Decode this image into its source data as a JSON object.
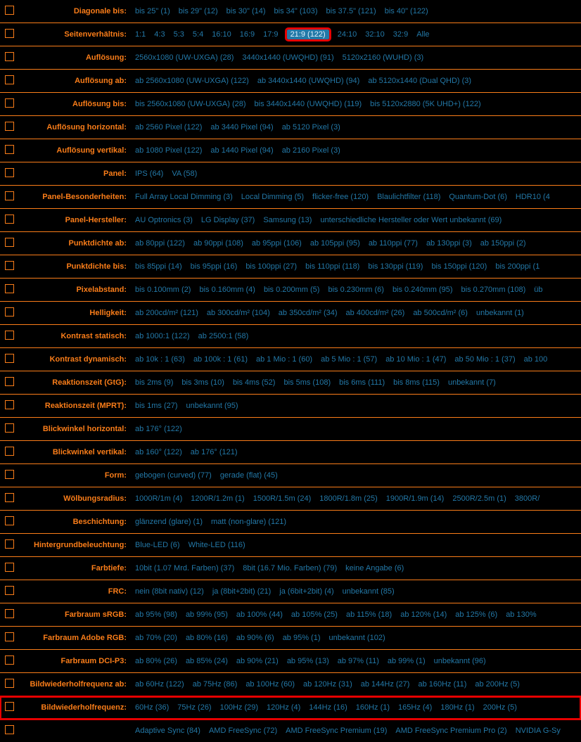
{
  "rows": [
    {
      "label": "Diagonale bis:",
      "opts": [
        [
          "bis 25\" (1)",
          0
        ],
        [
          "bis 29\" (12)",
          0
        ],
        [
          "bis 30\" (14)",
          0
        ],
        [
          "bis 34\" (103)",
          0
        ],
        [
          "bis 37.5\" (121)",
          0
        ],
        [
          "bis 40\" (122)",
          0
        ]
      ]
    },
    {
      "label": "Seitenverhältnis:",
      "hl": 1,
      "opts": [
        [
          "1:1",
          0
        ],
        [
          "4:3",
          0
        ],
        [
          "5:3",
          0
        ],
        [
          "5:4",
          0
        ],
        [
          "16:10",
          0
        ],
        [
          "16:9",
          0
        ],
        [
          "17:9",
          0
        ],
        [
          "21:9 (122)",
          1
        ],
        [
          "24:10",
          0
        ],
        [
          "32:10",
          0
        ],
        [
          "32:9",
          0
        ],
        [
          "Alle",
          0
        ]
      ]
    },
    {
      "label": "Auflösung:",
      "opts": [
        [
          "2560x1080 (UW-UXGA) (28)",
          0
        ],
        [
          "3440x1440 (UWQHD) (91)",
          0
        ],
        [
          "5120x2160 (WUHD) (3)",
          0
        ]
      ]
    },
    {
      "label": "Auflösung ab:",
      "opts": [
        [
          "ab 2560x1080 (UW-UXGA) (122)",
          0
        ],
        [
          "ab 3440x1440 (UWQHD) (94)",
          0
        ],
        [
          "ab 5120x1440 (Dual QHD) (3)",
          0
        ]
      ]
    },
    {
      "label": "Auflösung bis:",
      "opts": [
        [
          "bis 2560x1080 (UW-UXGA) (28)",
          0
        ],
        [
          "bis 3440x1440 (UWQHD) (119)",
          0
        ],
        [
          "bis 5120x2880 (5K UHD+) (122)",
          0
        ]
      ]
    },
    {
      "label": "Auflösung horizontal:",
      "opts": [
        [
          "ab 2560 Pixel (122)",
          0
        ],
        [
          "ab 3440 Pixel (94)",
          0
        ],
        [
          "ab 5120 Pixel (3)",
          0
        ]
      ]
    },
    {
      "label": "Auflösung vertikal:",
      "opts": [
        [
          "ab 1080 Pixel (122)",
          0
        ],
        [
          "ab 1440 Pixel (94)",
          0
        ],
        [
          "ab 2160 Pixel (3)",
          0
        ]
      ]
    },
    {
      "label": "Panel:",
      "opts": [
        [
          "IPS (64)",
          0
        ],
        [
          "VA (58)",
          0
        ]
      ]
    },
    {
      "label": "Panel-Besonderheiten:",
      "opts": [
        [
          "Full Array Local Dimming (3)",
          0
        ],
        [
          "Local Dimming (5)",
          0
        ],
        [
          "flicker-free (120)",
          0
        ],
        [
          "Blaulichtfilter (118)",
          0
        ],
        [
          "Quantum-Dot (6)",
          0
        ],
        [
          "HDR10 (4",
          0
        ]
      ]
    },
    {
      "label": "Panel-Hersteller:",
      "opts": [
        [
          "AU Optronics (3)",
          0
        ],
        [
          "LG Display (37)",
          0
        ],
        [
          "Samsung (13)",
          0
        ],
        [
          "unterschiedliche Hersteller oder Wert unbekannt (69)",
          0
        ]
      ]
    },
    {
      "label": "Punktdichte ab:",
      "opts": [
        [
          "ab 80ppi (122)",
          0
        ],
        [
          "ab 90ppi (108)",
          0
        ],
        [
          "ab 95ppi (106)",
          0
        ],
        [
          "ab 105ppi (95)",
          0
        ],
        [
          "ab 110ppi (77)",
          0
        ],
        [
          "ab 130ppi (3)",
          0
        ],
        [
          "ab 150ppi (2)",
          0
        ]
      ]
    },
    {
      "label": "Punktdichte bis:",
      "opts": [
        [
          "bis 85ppi (14)",
          0
        ],
        [
          "bis 95ppi (16)",
          0
        ],
        [
          "bis 100ppi (27)",
          0
        ],
        [
          "bis 110ppi (118)",
          0
        ],
        [
          "bis 130ppi (119)",
          0
        ],
        [
          "bis 150ppi (120)",
          0
        ],
        [
          "bis 200ppi (1",
          0
        ]
      ]
    },
    {
      "label": "Pixelabstand:",
      "opts": [
        [
          "bis 0.100mm (2)",
          0
        ],
        [
          "bis 0.160mm (4)",
          0
        ],
        [
          "bis 0.200mm (5)",
          0
        ],
        [
          "bis 0.230mm (6)",
          0
        ],
        [
          "bis 0.240mm (95)",
          0
        ],
        [
          "bis 0.270mm (108)",
          0
        ],
        [
          "üb",
          0
        ]
      ]
    },
    {
      "label": "Helligkeit:",
      "opts": [
        [
          "ab 200cd/m² (121)",
          0
        ],
        [
          "ab 300cd/m² (104)",
          0
        ],
        [
          "ab 350cd/m² (34)",
          0
        ],
        [
          "ab 400cd/m² (26)",
          0
        ],
        [
          "ab 500cd/m² (6)",
          0
        ],
        [
          "unbekannt (1)",
          0
        ]
      ]
    },
    {
      "label": "Kontrast statisch:",
      "opts": [
        [
          "ab 1000:1 (122)",
          0
        ],
        [
          "ab 2500:1 (58)",
          0
        ]
      ]
    },
    {
      "label": "Kontrast dynamisch:",
      "opts": [
        [
          "ab 10k : 1 (63)",
          0
        ],
        [
          "ab 100k : 1 (61)",
          0
        ],
        [
          "ab 1 Mio : 1 (60)",
          0
        ],
        [
          "ab 5 Mio : 1 (57)",
          0
        ],
        [
          "ab 10 Mio : 1 (47)",
          0
        ],
        [
          "ab 50 Mio : 1 (37)",
          0
        ],
        [
          "ab 100",
          0
        ]
      ]
    },
    {
      "label": "Reaktionszeit (GtG):",
      "opts": [
        [
          "bis 2ms (9)",
          0
        ],
        [
          "bis 3ms (10)",
          0
        ],
        [
          "bis 4ms (52)",
          0
        ],
        [
          "bis 5ms (108)",
          0
        ],
        [
          "bis 6ms (111)",
          0
        ],
        [
          "bis 8ms (115)",
          0
        ],
        [
          "unbekannt (7)",
          0
        ]
      ]
    },
    {
      "label": "Reaktionszeit (MPRT):",
      "opts": [
        [
          "bis 1ms (27)",
          0
        ],
        [
          "unbekannt (95)",
          0
        ]
      ]
    },
    {
      "label": "Blickwinkel horizontal:",
      "opts": [
        [
          "ab 176° (122)",
          0
        ]
      ]
    },
    {
      "label": "Blickwinkel vertikal:",
      "opts": [
        [
          "ab 160° (122)",
          0
        ],
        [
          "ab 176° (121)",
          0
        ]
      ]
    },
    {
      "label": "Form:",
      "opts": [
        [
          "gebogen (curved) (77)",
          0
        ],
        [
          "gerade (flat) (45)",
          0
        ]
      ]
    },
    {
      "label": "Wölbungsradius:",
      "opts": [
        [
          "1000R/1m (4)",
          0
        ],
        [
          "1200R/1.2m (1)",
          0
        ],
        [
          "1500R/1.5m (24)",
          0
        ],
        [
          "1800R/1.8m (25)",
          0
        ],
        [
          "1900R/1.9m (14)",
          0
        ],
        [
          "2500R/2.5m (1)",
          0
        ],
        [
          "3800R/",
          0
        ]
      ]
    },
    {
      "label": "Beschichtung:",
      "opts": [
        [
          "glänzend (glare) (1)",
          0
        ],
        [
          "matt (non-glare) (121)",
          0
        ]
      ]
    },
    {
      "label": "Hintergrundbeleuchtung:",
      "opts": [
        [
          "Blue-LED (6)",
          0
        ],
        [
          "White-LED (116)",
          0
        ]
      ]
    },
    {
      "label": "Farbtiefe:",
      "opts": [
        [
          "10bit (1.07 Mrd. Farben) (37)",
          0
        ],
        [
          "8bit (16.7 Mio. Farben) (79)",
          0
        ],
        [
          "keine Angabe (6)",
          0
        ]
      ]
    },
    {
      "label": "FRC:",
      "opts": [
        [
          "nein (8bit nativ) (12)",
          0
        ],
        [
          "ja (8bit+2bit) (21)",
          0
        ],
        [
          "ja (6bit+2bit) (4)",
          0
        ],
        [
          "unbekannt (85)",
          0
        ]
      ]
    },
    {
      "label": "Farbraum sRGB:",
      "opts": [
        [
          "ab 95% (98)",
          0
        ],
        [
          "ab 99% (95)",
          0
        ],
        [
          "ab 100% (44)",
          0
        ],
        [
          "ab 105% (25)",
          0
        ],
        [
          "ab 115% (18)",
          0
        ],
        [
          "ab 120% (14)",
          0
        ],
        [
          "ab 125% (6)",
          0
        ],
        [
          "ab 130%",
          0
        ]
      ]
    },
    {
      "label": "Farbraum Adobe RGB:",
      "opts": [
        [
          "ab 70% (20)",
          0
        ],
        [
          "ab 80% (16)",
          0
        ],
        [
          "ab 90% (6)",
          0
        ],
        [
          "ab 95% (1)",
          0
        ],
        [
          "unbekannt (102)",
          0
        ]
      ]
    },
    {
      "label": "Farbraum DCI-P3:",
      "opts": [
        [
          "ab 80% (26)",
          0
        ],
        [
          "ab 85% (24)",
          0
        ],
        [
          "ab 90% (21)",
          0
        ],
        [
          "ab 95% (13)",
          0
        ],
        [
          "ab 97% (11)",
          0
        ],
        [
          "ab 99% (1)",
          0
        ],
        [
          "unbekannt (96)",
          0
        ]
      ]
    },
    {
      "label": "Bildwiederholfrequenz ab:",
      "opts": [
        [
          "ab 60Hz (122)",
          0
        ],
        [
          "ab 75Hz (86)",
          0
        ],
        [
          "ab 100Hz (60)",
          0
        ],
        [
          "ab 120Hz (31)",
          0
        ],
        [
          "ab 144Hz (27)",
          0
        ],
        [
          "ab 160Hz (11)",
          0
        ],
        [
          "ab 200Hz (5)",
          0
        ]
      ]
    },
    {
      "label": "Bildwiederholfrequenz:",
      "hl": 2,
      "opts": [
        [
          "60Hz (36)",
          0
        ],
        [
          "75Hz (26)",
          0
        ],
        [
          "100Hz (29)",
          0
        ],
        [
          "120Hz (4)",
          0
        ],
        [
          "144Hz (16)",
          0
        ],
        [
          "160Hz (1)",
          0
        ],
        [
          "165Hz (4)",
          0
        ],
        [
          "180Hz (1)",
          0
        ],
        [
          "200Hz (5)",
          0
        ]
      ]
    },
    {
      "label": "",
      "opts": [
        [
          "Adaptive Sync (84)",
          0
        ],
        [
          "AMD FreeSync (72)",
          0
        ],
        [
          "AMD FreeSync Premium (19)",
          0
        ],
        [
          "AMD FreeSync Premium Pro (2)",
          0
        ],
        [
          "NVIDIA G-Sy",
          0
        ]
      ]
    }
  ]
}
